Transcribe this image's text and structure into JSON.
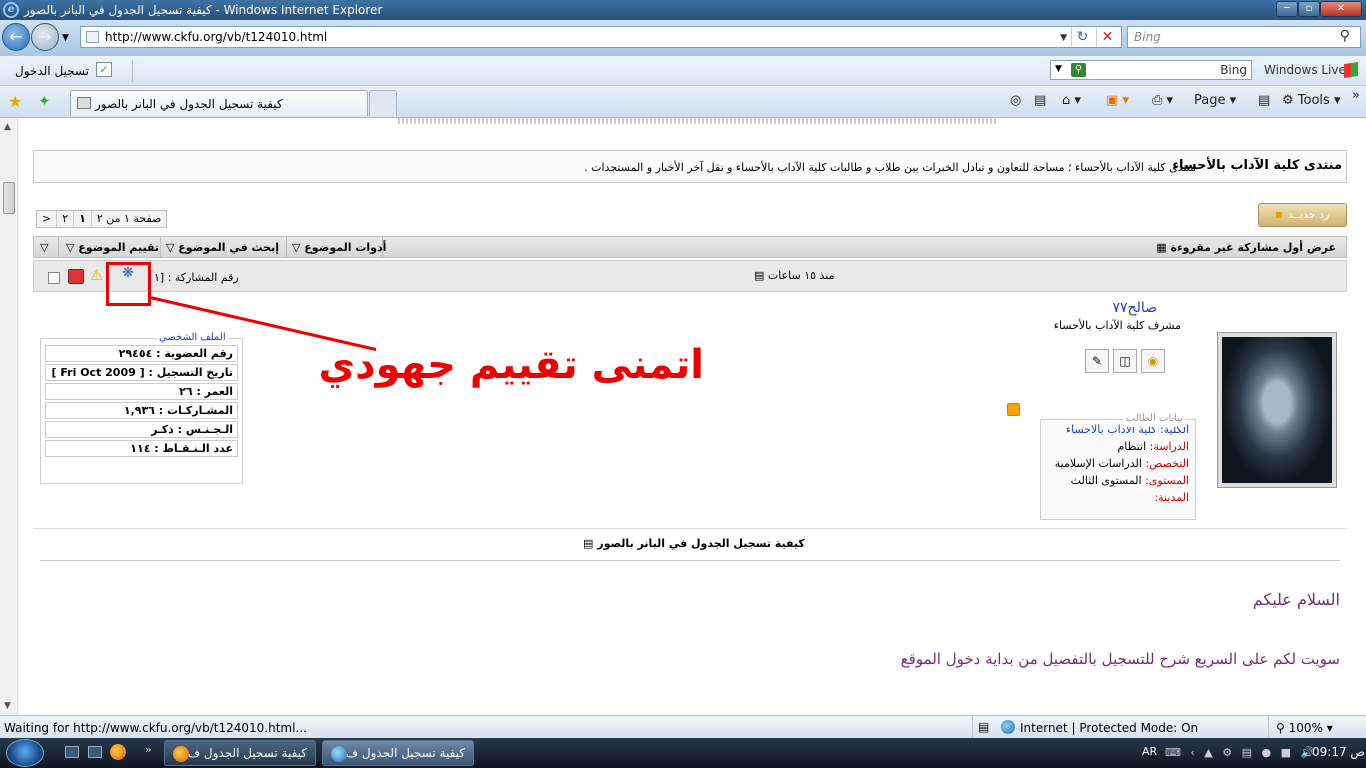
{
  "window": {
    "title": "كيفية تسجيل الجدول في البانر بالصور - Windows Internet Explorer",
    "min_label": "─",
    "max_label": "▫",
    "close_label": "✕"
  },
  "address_bar": {
    "url": "http://www.ckfu.org/vb/t124010.html",
    "search_placeholder": "Bing"
  },
  "links_bar": {
    "login_label": "تسجيل الدخول",
    "bing_label": "Bing",
    "windows_live_label": "Windows Live"
  },
  "tabs": {
    "active_tab_title": "كيفية تسجيل الجدول في البانر بالصور",
    "page_label": "Page",
    "tools_label": "Tools"
  },
  "forum": {
    "name": "منتدى كلية الآداب بالأحساء",
    "description": "منتدى كلية الآداب بالأحساء ؛ مساحة للتعاون و تبادل الخبرات بين طلاب و طالبات كلية الآداب بالأحساء و نقل آخر الأخبار و المستجدات ."
  },
  "pager": {
    "next": ">",
    "page2": "٢",
    "page1": "١",
    "info": "صفحة ١ من ٢"
  },
  "reply_button": "رد جديــد",
  "thread_toolbar": {
    "first_unread": "عرض أول مشاركة غير مقروءة",
    "tools": "أدوات الموضوع",
    "search": "إبحث في الموضوع",
    "rate": "تقييم الموضوع"
  },
  "post": {
    "time": "منذ ١٥ ساعات",
    "post_number_label": "رقم المشاركة : [١",
    "username": "صالح٧٧",
    "user_title": "مشرف كلية الآداب بالأحساء",
    "annotation_text": "اتمنى تقييم جهودي",
    "student_box_header": "بيانات الطالب",
    "student": {
      "college_label": "الكلية:",
      "college_value": "كلية الآداب بالاحساء",
      "study_label": "الدراسة:",
      "study_value": "انتظام",
      "major_label": "التخصص:",
      "major_value": "الدراسات الإسلامية",
      "level_label": "المستوى:",
      "level_value": "المستوى الثالث",
      "city_label": "المدينة:",
      "city_value": ""
    },
    "profile_header": "الملف الشخصي",
    "profile_rows": [
      "رقم العضوية : ٢٩٤٥٤",
      "تاريخ التسجيل : [ Fri Oct 2009 ]",
      "العمر : ٢٦",
      "المشـاركـات : ١,٩٣٦",
      "الـجـنـس : ذكـر",
      "عدد الـنـقـاط : ١١٤"
    ],
    "thread_title": "كيفية تسجيل الجدول في البانر بالصور",
    "message_line1": "السلام عليكم",
    "message_line2": "سويت لكم على السريع شرح للتسجيل بالتفصيل من بداية دخول الموقع"
  },
  "status_bar": {
    "status_text": "Waiting for http://www.ckfu.org/vb/t124010.html...",
    "zone_text": "Internet | Protected Mode: On",
    "zoom_text": "100%"
  },
  "taskbar": {
    "button1": "كيفية تسجيل الجدول ف...",
    "button2": "كيفية تسجيل الجدول ف...",
    "language": "AR",
    "clock": "ص 09:17"
  },
  "colors": {
    "annotation_red": "#e00000",
    "username_blue": "#1e3dbd",
    "message_purple": "#7a2a78"
  }
}
